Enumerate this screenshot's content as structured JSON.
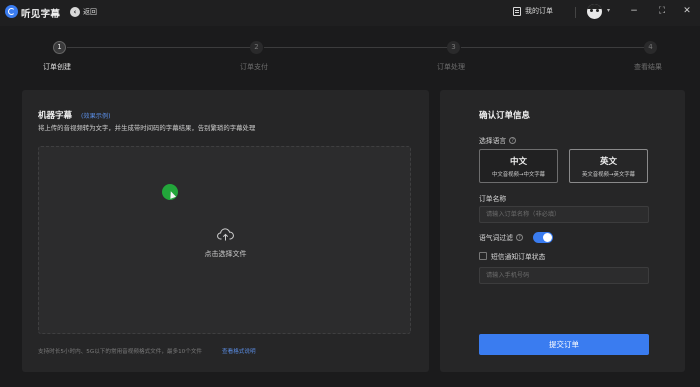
{
  "app": {
    "name": "听见字幕",
    "back_label": "返回"
  },
  "titlebar": {
    "orders_label": "我的订单",
    "avatar_caret": "▾",
    "minimize": "−",
    "restore": "⛶",
    "close": "✕"
  },
  "stepper": {
    "steps": [
      {
        "number": "1",
        "label": "订单创建",
        "active": true
      },
      {
        "number": "2",
        "label": "订单支付",
        "active": false
      },
      {
        "number": "3",
        "label": "订单处理",
        "active": false
      },
      {
        "number": "4",
        "label": "查看结果",
        "active": false
      }
    ]
  },
  "left": {
    "title": "机器字幕",
    "example_link": "(效果示例)",
    "description": "将上传的音视频转为文字，并生成带时间码的字幕结果，告别繁琐的字幕处理",
    "upload_label": "点击选择文件",
    "footer_note": "支持时长5小时内、5G以下的常用音视频格式文件，最多10个文件",
    "footer_link": "查看格式说明"
  },
  "right": {
    "title": "确认订单信息",
    "language_label": "选择语言",
    "languages": [
      {
        "name": "中文",
        "sub": "中文音视频→中文字幕",
        "selected": true
      },
      {
        "name": "英文",
        "sub": "英文音视频→英文字幕",
        "selected": false
      }
    ],
    "order_name_label": "订单名称",
    "order_name_placeholder": "请输入订单名称（非必填）",
    "filler_label": "语气词过滤",
    "filler_enabled": true,
    "sms_label": "短信通知订单状态",
    "phone_placeholder": "请输入手机号码",
    "submit_label": "提交订单"
  },
  "colors": {
    "accent": "#3a7cf0",
    "link": "#5b8ee6",
    "background": "#1b1b1c",
    "panel": "#262627"
  },
  "icons": [
    "app-logo-icon",
    "back-arrow-icon",
    "orders-icon",
    "avatar-icon",
    "help-icon",
    "cloud-upload-icon"
  ]
}
